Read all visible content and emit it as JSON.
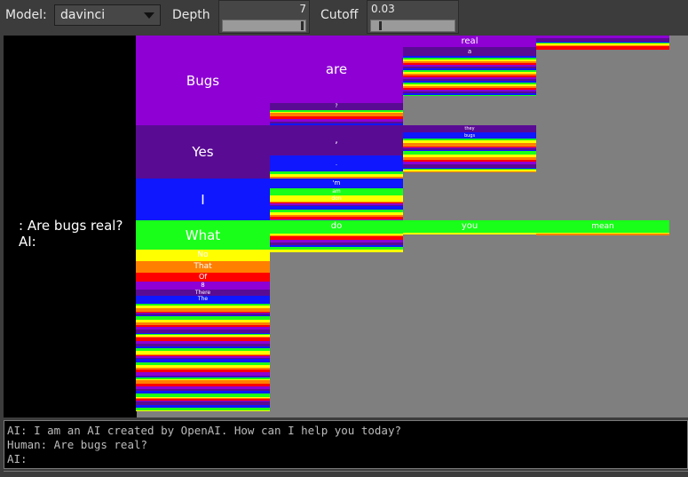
{
  "toolbar": {
    "model_label": "Model:",
    "model_value": "davinci",
    "depth_label": "Depth",
    "depth_value": "7",
    "depth_level": 0.96,
    "cutoff_label": "Cutoff",
    "cutoff_value": "0.03",
    "cutoff_level": 0.1
  },
  "prompt_text": ": Are bugs real?\nAI:",
  "tree": {
    "col1": [
      {
        "label": "Bugs",
        "color": "#8e00d4"
      },
      {
        "label": "Yes",
        "color": "#5a0b94"
      },
      {
        "label": "I",
        "color": "#0f17ff"
      },
      {
        "label": "What",
        "color": "#19ff19"
      },
      {
        "label": "No",
        "color": "#ffff00"
      },
      {
        "label": "That",
        "color": "#ff7f00"
      },
      {
        "label": "Of",
        "color": "#ff0000"
      },
      {
        "label": "8",
        "color": "#8e00d4"
      },
      {
        "label": "There",
        "color": "#5a0b94"
      },
      {
        "label": "The",
        "color": "#0f17ff"
      }
    ],
    "bugs_next": [
      {
        "label": "are",
        "color": "#8e00d4"
      },
      {
        "label": "?",
        "color": "#5a0b94"
      }
    ],
    "are_next": [
      {
        "label": "real",
        "color": "#8e00d4"
      },
      {
        "label": "a",
        "color": "#5a0b94"
      }
    ],
    "yes_next": [
      {
        "label": ",",
        "color": "#5a0b94"
      },
      {
        "label": ".",
        "color": "#0f17ff"
      }
    ],
    "yes_comma_next": [
      {
        "label": "they",
        "color": "#5a0b94"
      },
      {
        "label": "bugs",
        "color": "#0f17ff"
      }
    ],
    "i_next": [
      {
        "label": "'m",
        "color": "#0f17ff"
      },
      {
        "label": "am",
        "color": "#19ff19"
      },
      {
        "label": "don",
        "color": "#ffff00"
      }
    ],
    "what_next": [
      {
        "label": "do",
        "color": "#19ff19"
      }
    ],
    "do_next": [
      {
        "label": "you",
        "color": "#19ff19"
      }
    ],
    "you_next": [
      {
        "label": "mean",
        "color": "#19ff19"
      }
    ]
  },
  "console": {
    "lines": [
      "AI: I am an AI created by OpenAI. How can I help you today?",
      "Human: Are bugs real?",
      "AI:"
    ]
  },
  "palette": [
    "#5a0b94",
    "#0f17ff",
    "#19ff19",
    "#ffff00",
    "#ff7f00",
    "#ff0000",
    "#8e00d4"
  ]
}
